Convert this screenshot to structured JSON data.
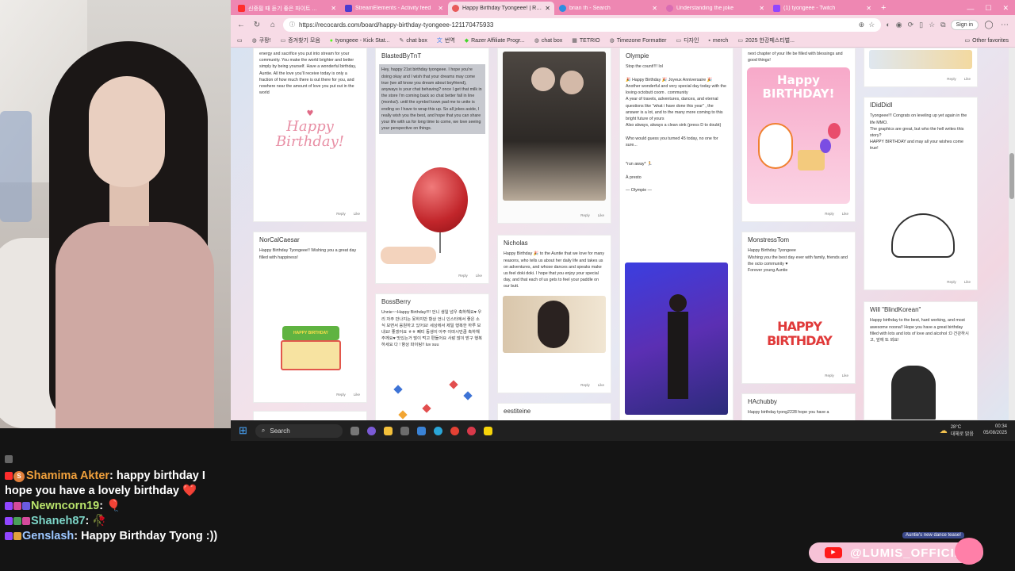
{
  "tabs": [
    {
      "label": "신중필 때 듣기 좋은 파이트 ..."
    },
    {
      "label": "StreamElements - Activity feed"
    },
    {
      "label": "Happy Birthday Tyongeee! | Reco",
      "active": true
    },
    {
      "label": "brian th - Search"
    },
    {
      "label": "Understanding the joke"
    },
    {
      "label": "(1) tyongeee - Twitch"
    }
  ],
  "address": {
    "url": "https://recocards.com/board/happy-birthday-tyongeee-121170475933",
    "signin": "Sign in"
  },
  "bookmarks": [
    {
      "label": "쿠팡!"
    },
    {
      "label": "증겨찾기 모음"
    },
    {
      "label": "tyongeee - Kick Stat..."
    },
    {
      "label": "chat box"
    },
    {
      "label": "번역"
    },
    {
      "label": "Razer Affiliate Progr..."
    },
    {
      "label": "chat box"
    },
    {
      "label": "TETRIO"
    },
    {
      "label": "Timezone Formatter"
    },
    {
      "label": "디자인"
    },
    {
      "label": "merch"
    },
    {
      "label": "2025 한강페스티벌..."
    }
  ],
  "other_favorites": "Other favorites",
  "action_labels": {
    "reply": "Reply",
    "like": "Like"
  },
  "cards": {
    "c1": {
      "body": "energy and sacrifice you put into stream for your community. You make the world brighter and better simply by being yourself. Have a wonderful birthday, Auntie. All the love you'll receive today is only a fraction of how much there is out there for you, and nowhere near the amount of love you put out in the world",
      "art": "Happy Birthday!"
    },
    "c2": {
      "name": "NorCalCaesar",
      "body": "Happy Birthday Tyongeee!! Wishing you a great day filled with happiness!",
      "art": "HAPPY BIRTHDAY"
    },
    "c3": {
      "name": "BlastedByTnT",
      "body": "Hey, happy 21st birthday tyongeee. I hope you're doing okay and I wish that your dreams may come true (we all know you dream about boyfriend), anyways is your chat behaving? once I get that milk in the store I'm coming back so chat better fall in line (monka!). until the symbol kown pad me to unite is ending so I have to wrap this up. So all jokes aside, I really wish you the best, and hope that you can share your life with us for long time to come, we love seeing your perspective on things."
    },
    "c4": {
      "name": "BossBerry",
      "body": "Unnie~~Happy Birthday!!!! 언니 생일 넘우 축하해요♥ 우리 자주 만나지는 못하지만 항상 언니 인스타에서 좋은 소식 보면서 응원하고 있어요! 세상에서 제일 행복한 하루 보내요! 좋겠어요 ㅎㅎ 뻬티 동생이 아주 이따시만큼 축하해주께요♥ 맛있는거 많이 먹고 편들어요 사랑 많이 받구 행복하세요 다 ! 항상 파이팅!! luv suu"
    },
    "c5": {
      "name": "Nicholas",
      "body": "Happy Birthday 🎉 to the Auntie that we love for many reasons, who tells us about her daily life and takes us on adventures, and whose dances and speaks make us feel doki doki. I hope that you enjoy your special day, and that each of us gets to feel your paddle on our butt."
    },
    "c6": {
      "name": "eestiteine"
    },
    "c7": {
      "name": "Olympie",
      "body": "Stop the count!!!! lol\n\n🎉 Happy Birthday 🎉 Joyeux Anniversaire 🎉\nAnother wonderful and very special day today with the loving octobutt coom . community\nA year of travels, adventures, dances, and eternal questions like \"what i have done this year\" , the answer is a lot, and to the many more coming to this bright future of yours\nAlso always, always a clean sink (press D to doubt)\n\nWho would guess you turned 45 today, no one for sure...\n\n\n*run away* 🏃\n\nÀ presto\n\n— Olympie —"
    },
    "c8": {
      "body": "next chapter of your life be filled with blessings and good things!",
      "art": "Happy BIRTHDAY!"
    },
    "c9": {
      "name": "MonstressTom",
      "body": "Happy Birthday Tyongeee\nWishing you the best day ever with family, friends and the octo community ♥\nForever young Auntie",
      "art": "HAPPY BIRTHDAY"
    },
    "c10": {
      "name": "HAchubby",
      "body": "Happy birthday tyong2228 hope you have a"
    },
    "c11": {
      "name": "IDidDidI",
      "body": "Tyongeee!!! Congrats on leveling up yet again in the life MMO.\nThe graphics are great, but who the hell writes this story?\nHAPPY BIRTHDAY and may all your wishes come true!"
    },
    "c12": {
      "name": "Will \"BlindKorean\"",
      "body": "Happy birthday to the best, hard working, and most awesome noona!! Hope you have a great birthday filled with lots and lots of love and alcohol :D 건강하시고, 앞에 또 뵈요!"
    }
  },
  "taskbar": {
    "search": "Search",
    "temp": "28°C",
    "weather": "대체로 맑음",
    "time": "00:34",
    "date": "05/08/2025"
  },
  "chat": [
    {
      "user": "Shamima Akter",
      "color": "#f0a03c",
      "text": "happy birthday I hope you have a lovely birthday ❤️",
      "sep": ": "
    },
    {
      "user": "Newncorn19",
      "color": "#b9e36b",
      "text": "🎈",
      "sep": ": "
    },
    {
      "user": "Shaneh87",
      "color": "#7dd6c8",
      "text": "🥀",
      "sep": ": "
    },
    {
      "user": "Genslash",
      "color": "#9cc7ff",
      "text": "Happy Birthday Tyong :))",
      "sep": ": "
    }
  ],
  "watermark": {
    "tag": "Auntie's new dance tease!",
    "handle": "@LUMIS_OFFICIAL"
  }
}
